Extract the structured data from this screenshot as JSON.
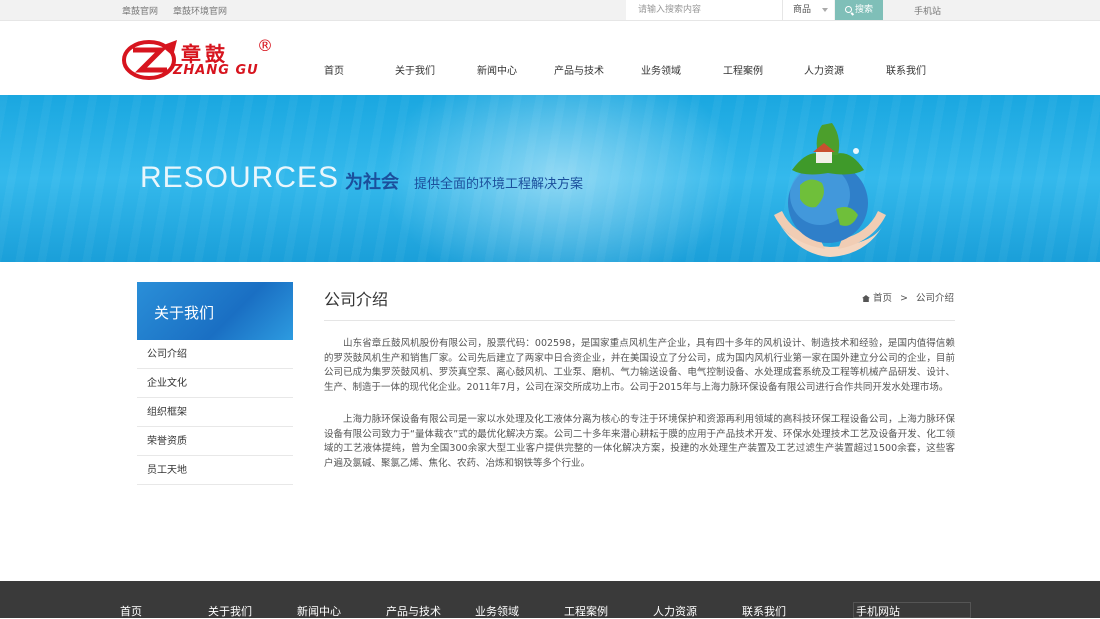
{
  "topbar": {
    "links": [
      "章鼓官网",
      "章鼓环境官网"
    ],
    "search_placeholder": "请输入搜索内容",
    "search_category": "商品",
    "search_button": "搜索",
    "mobile": "手机站"
  },
  "logo": {
    "cn": "章鼓",
    "en": "ZHANG GU",
    "reg": "®"
  },
  "nav": [
    "首页",
    "关于我们",
    "新闻中心",
    "产品与技术",
    "业务领域",
    "工程案例",
    "人力资源",
    "联系我们"
  ],
  "banner": {
    "en": "RESOURCES",
    "cn1": "为社会",
    "cn2": "提供全面的环境工程解决方案"
  },
  "sidebar": {
    "title": "关于我们",
    "items": [
      "公司介绍",
      "企业文化",
      "组织框架",
      "荣誉资质",
      "员工天地"
    ]
  },
  "content": {
    "title": "公司介绍",
    "breadcrumb": {
      "home": "首页",
      "sep": ">",
      "current": "公司介绍"
    },
    "paragraphs": [
      "山东省章丘鼓风机股份有限公司，股票代码：002598，是国家重点风机生产企业，具有四十多年的风机设计、制造技术和经验，是国内值得信赖的罗茨鼓风机生产和销售厂家。公司先后建立了两家中日合资企业，并在美国设立了分公司，成为国内风机行业第一家在国外建立分公司的企业，目前公司已成为集罗茨鼓风机、罗茨真空泵、离心鼓风机、工业泵、磨机、气力输送设备、电气控制设备、水处理成套系统及工程等机械产品研发、设计、生产、制造于一体的现代化企业。2011年7月，公司在深交所成功上市。公司于2015年与上海力脉环保设备有限公司进行合作共同开发水处理市场。",
      "上海力脉环保设备有限公司是一家以水处理及化工液体分离为核心的专注于环境保护和资源再利用领域的高科技环保工程设备公司，上海力脉环保设备有限公司致力于“量体裁衣”式的最优化解决方案。公司二十多年来潜心耕耘于膜的应用于产品技术开发、环保水处理技术工艺及设备开发、化工领域的工艺液体提纯，曾为全国300余家大型工业客户提供完整的一体化解决方案，投建的水处理生产装置及工艺过滤生产装置超过1500余套，这些客户遍及氯碱、聚氯乙烯、焦化、农药、冶炼和钢铁等多个行业。"
    ]
  },
  "footer": {
    "links": [
      "首页",
      "关于我们",
      "新闻中心",
      "产品与技术",
      "业务领域",
      "工程案例",
      "人力资源",
      "联系我们"
    ],
    "mobile": "手机网站"
  },
  "colors": {
    "brand_red": "#d7141e",
    "banner_blue": "#1aa7e0",
    "footer_bg": "#3a3a3a",
    "search_btn": "#7fbfb8"
  }
}
